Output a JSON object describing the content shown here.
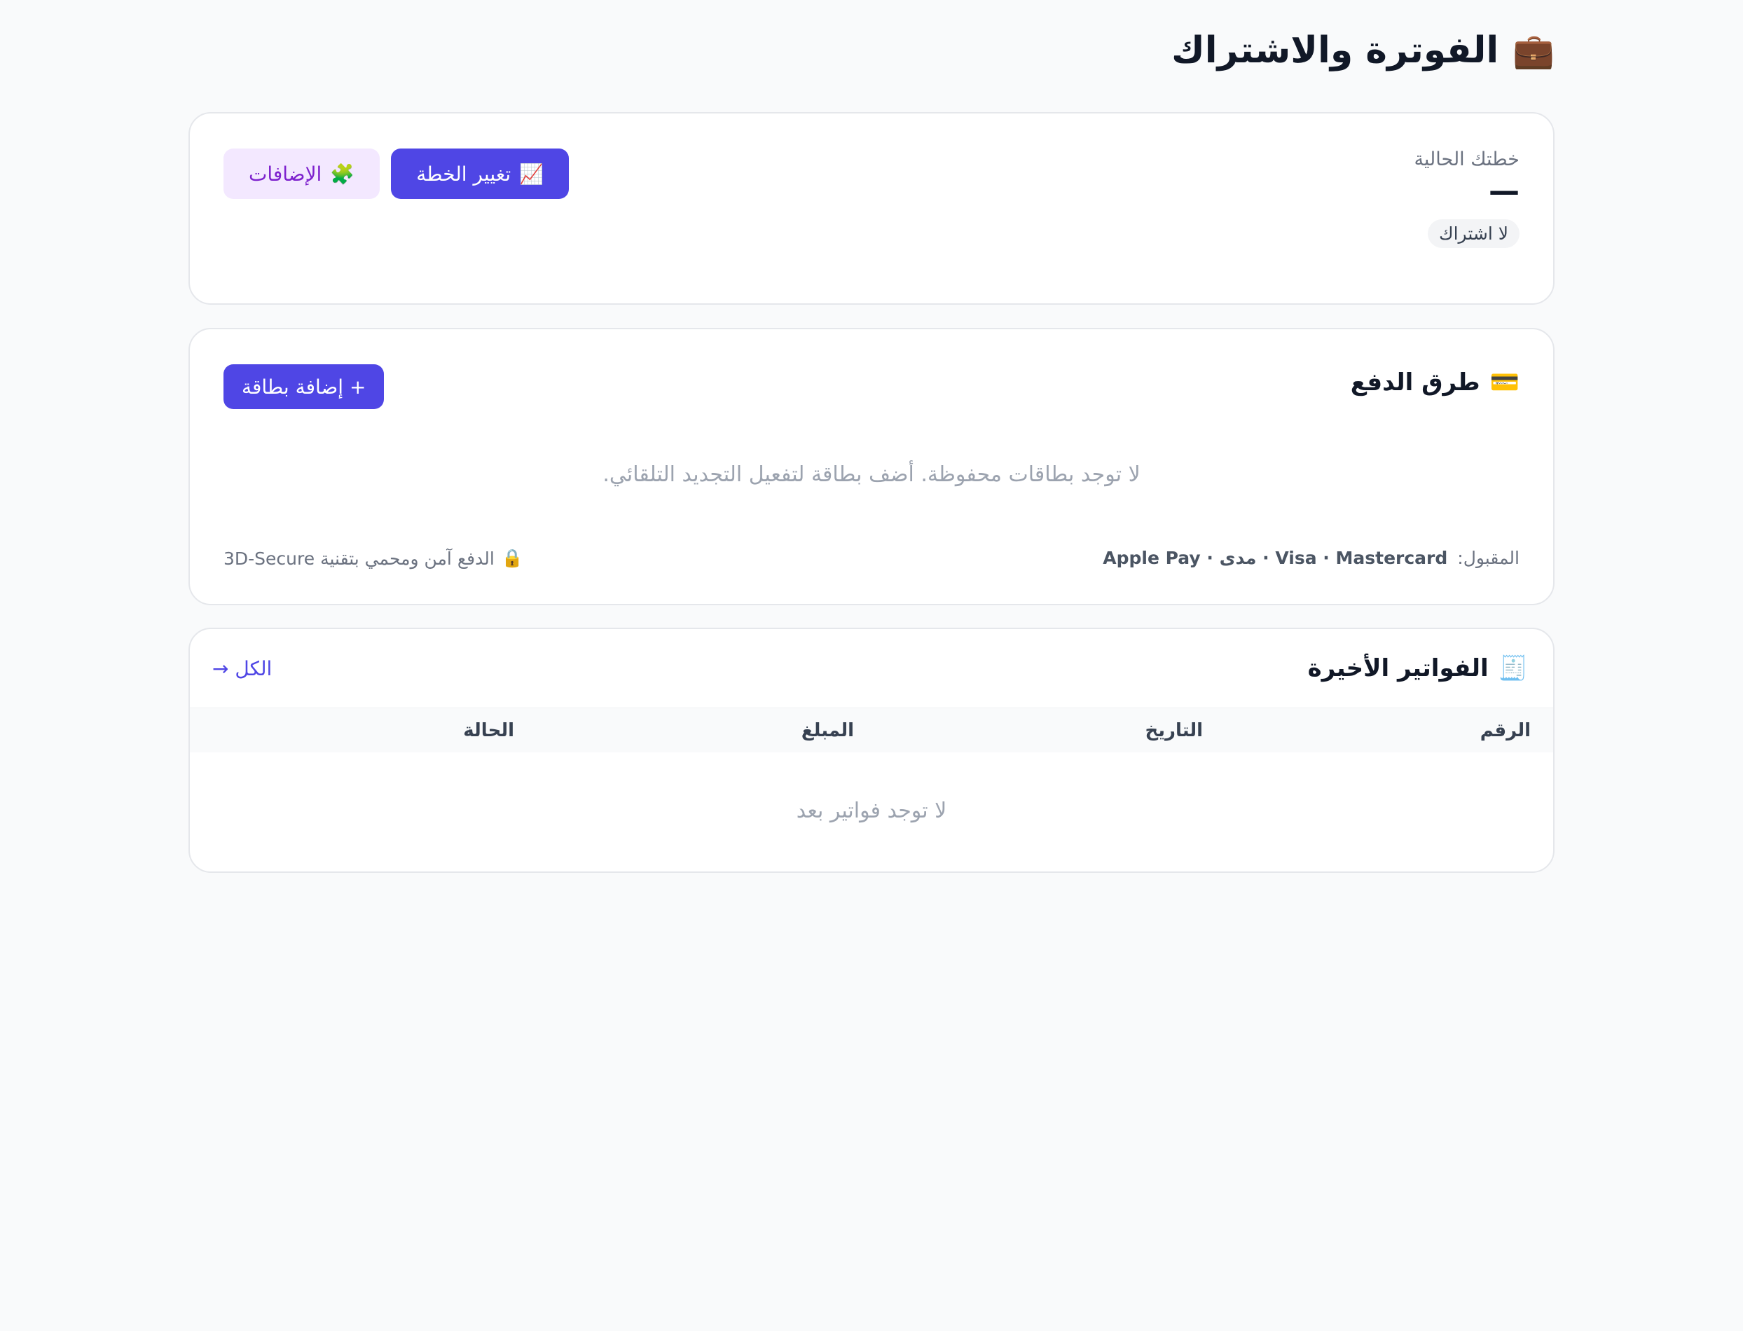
{
  "header": {
    "icon": "briefcase-icon",
    "icon_glyph": "💼",
    "title": "الفوترة والاشتراك"
  },
  "plan": {
    "label": "خطتك الحالية",
    "value": "—",
    "badge": "لا اشتراك",
    "addons_button": "الإضافات",
    "addons_icon": "puzzle-icon",
    "addons_glyph": "🧩",
    "change_button": "تغيير الخطة",
    "change_icon": "chart-up-icon",
    "change_glyph": "📈"
  },
  "payments": {
    "title": "طرق الدفع",
    "icon": "credit-card-icon",
    "icon_glyph": "💳",
    "add_button": "+ إضافة بطاقة",
    "empty_text": "لا توجد بطاقات محفوظة. أضف بطاقة لتفعيل التجديد التلقائي.",
    "accepted_label": "المقبول:",
    "accepted_methods": "Apple Pay · مدى · Visa · Mastercard",
    "secure_text": "الدفع آمن ومحمي بتقنية 3D-Secure",
    "secure_icon": "lock-icon",
    "secure_glyph": "🔒"
  },
  "invoices": {
    "title": "الفواتير الأخيرة",
    "icon": "receipt-icon",
    "icon_glyph": "🧾",
    "view_all": "الكل →",
    "columns": [
      "الرقم",
      "التاريخ",
      "المبلغ",
      "الحالة"
    ],
    "empty_text": "لا توجد فواتير بعد"
  },
  "colors": {
    "primary": "#4f46e5",
    "addon_bg": "#f3e8ff",
    "addon_text": "#7e22ce",
    "background": "#f9fafb"
  }
}
